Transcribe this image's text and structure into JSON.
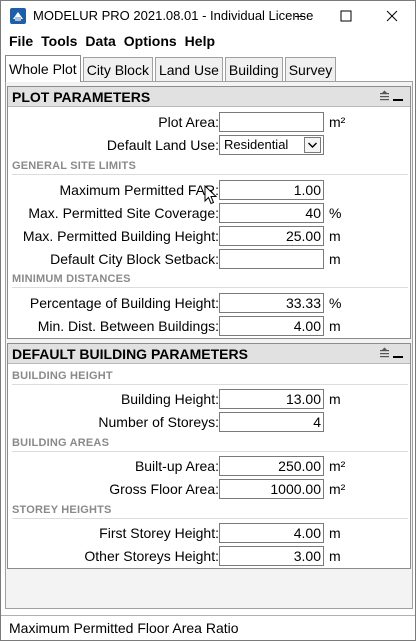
{
  "window": {
    "title": "MODELUR PRO 2021.08.01 - Individual License"
  },
  "menu": [
    "File",
    "Tools",
    "Data",
    "Options",
    "Help"
  ],
  "tabs": [
    "Whole Plot",
    "City Block",
    "Land Use",
    "Building",
    "Survey"
  ],
  "plot_panel": {
    "title": "PLOT PARAMETERS",
    "plot_area": {
      "label": "Plot Area:",
      "value": "",
      "unit": "m²"
    },
    "land_use": {
      "label": "Default Land Use:",
      "value": "Residential"
    },
    "site_limits_heading": "GENERAL SITE LIMITS",
    "far": {
      "label": "Maximum Permitted FAR:",
      "value": "1.00",
      "unit": ""
    },
    "coverage": {
      "label": "Max. Permitted Site Coverage:",
      "value": "40",
      "unit": "%"
    },
    "bldg_height": {
      "label": "Max. Permitted Building Height:",
      "value": "25.00",
      "unit": "m"
    },
    "setback": {
      "label": "Default City Block Setback:",
      "value": "",
      "unit": "m"
    },
    "min_dist_heading": "MINIMUM DISTANCES",
    "pct_height": {
      "label": "Percentage of Building Height:",
      "value": "33.33",
      "unit": "%"
    },
    "min_dist": {
      "label": "Min. Dist. Between Buildings:",
      "value": "4.00",
      "unit": "m"
    }
  },
  "building_panel": {
    "title": "DEFAULT BUILDING PARAMETERS",
    "height_heading": "BUILDING HEIGHT",
    "height": {
      "label": "Building Height:",
      "value": "13.00",
      "unit": "m"
    },
    "storeys": {
      "label": "Number of Storeys:",
      "value": "4",
      "unit": ""
    },
    "areas_heading": "BUILDING AREAS",
    "builtup": {
      "label": "Built-up Area:",
      "value": "250.00",
      "unit": "m²"
    },
    "gfa": {
      "label": "Gross Floor Area:",
      "value": "1000.00",
      "unit": "m²"
    },
    "storey_heading": "STOREY HEIGHTS",
    "first": {
      "label": "First Storey Height:",
      "value": "4.00",
      "unit": "m"
    },
    "other": {
      "label": "Other Storeys Height:",
      "value": "3.00",
      "unit": "m"
    }
  },
  "status": "Maximum Permitted Floor Area Ratio",
  "colors": {
    "accent": "#1f5fa8",
    "panel_header": "#e1e1e1",
    "section_text": "#8a8a8a"
  }
}
